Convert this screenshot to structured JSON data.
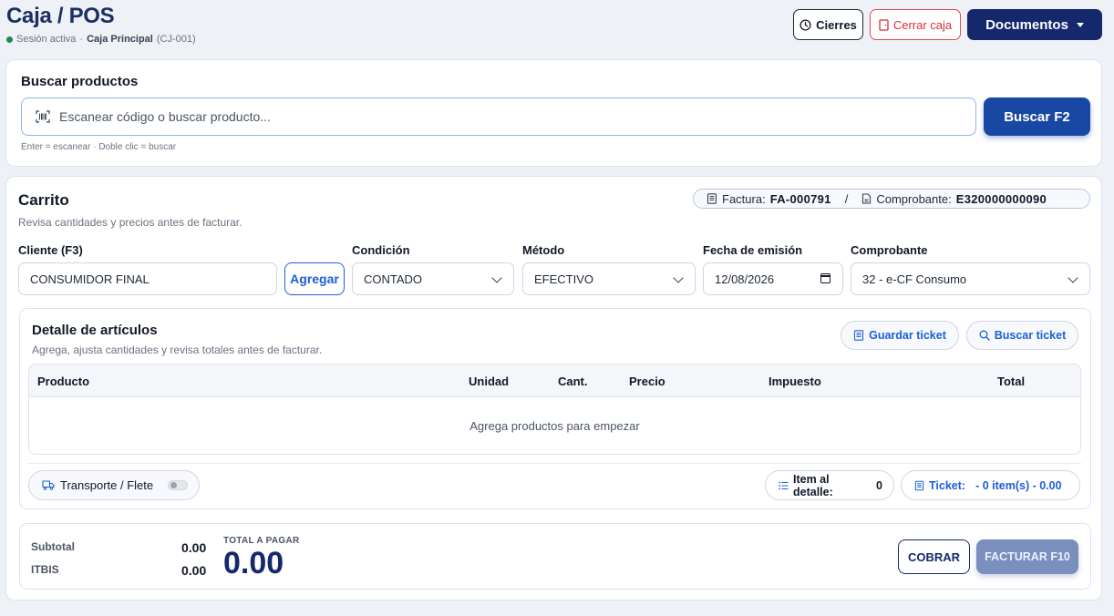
{
  "header": {
    "title": "Caja / POS",
    "session_status": "Sesión activa",
    "session_sep": "·",
    "register_name": "Caja Principal",
    "register_code": "(CJ-001)",
    "status_color": "#1e8a4c",
    "buttons": {
      "cierres": "Cierres",
      "cerrar_caja": "Cerrar caja",
      "documentos": "Documentos"
    }
  },
  "search": {
    "title": "Buscar productos",
    "placeholder": "Escanear código o buscar producto...",
    "button": "Buscar F2",
    "hint": "Enter = escanear · Doble clic = buscar"
  },
  "cart": {
    "title": "Carrito",
    "subtitle": "Revisa cantidades y precios antes de facturar.",
    "invoice_label": "Factura:",
    "invoice_number": "FA-000791",
    "separator": "/",
    "voucher_label": "Comprobante:",
    "voucher_number": "E320000000090",
    "fields": {
      "cliente_label": "Cliente (F3)",
      "cliente_value": "CONSUMIDOR FINAL",
      "agregar_button": "Agregar",
      "condicion_label": "Condición",
      "condicion_value": "CONTADO",
      "metodo_label": "Método",
      "metodo_value": "EFECTIVO",
      "fecha_label": "Fecha de emisión",
      "fecha_value": "12/08/2026",
      "comprobante_label": "Comprobante",
      "comprobante_value": "32 - e-CF Consumo"
    }
  },
  "detail": {
    "title": "Detalle de artículos",
    "subtitle": "Agrega, ajusta cantidades y revisa totales antes de facturar.",
    "guardar_ticket": "Guardar ticket",
    "buscar_ticket": "Buscar ticket",
    "columns": [
      "Producto",
      "Unidad",
      "Cant.",
      "Precio",
      "Impuesto",
      "Total"
    ],
    "empty_message": "Agrega productos para empezar",
    "transport_label": "Transporte / Flete",
    "transport_enabled": false,
    "item_detalle_label": "Item al detalle:",
    "item_detalle_value": "0",
    "ticket_label": "Ticket:",
    "ticket_value": "- 0 item(s) - 0.00"
  },
  "totals": {
    "subtotal_label": "Subtotal",
    "subtotal_value": "0.00",
    "itbis_label": "ITBIS",
    "itbis_value": "0.00",
    "total_label": "TOTAL A PAGAR",
    "total_value": "0.00",
    "cobrar_button": "COBRAR",
    "facturar_button": "FACTURAR F10"
  },
  "colors": {
    "primary": "#14286b",
    "accent": "#1d5fd6",
    "danger": "#d92d3a"
  }
}
